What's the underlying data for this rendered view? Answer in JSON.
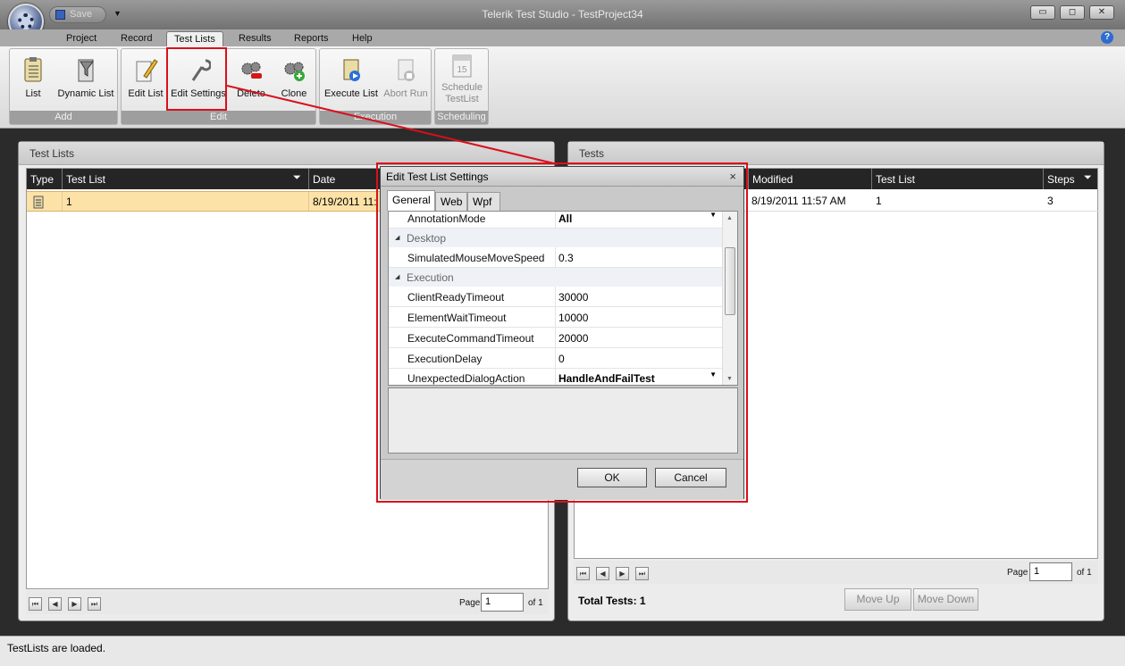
{
  "window": {
    "title": "Telerik Test Studio - TestProject34",
    "qat_save": "Save",
    "controls": [
      "▭",
      "◻",
      "✕"
    ]
  },
  "menu": {
    "tabs": [
      "Project",
      "Record",
      "Test Lists",
      "Results",
      "Reports",
      "Help"
    ],
    "active": "Test Lists",
    "help": "?"
  },
  "ribbon": {
    "groups": [
      {
        "label": "Add",
        "buttons": [
          "List",
          "Dynamic List"
        ]
      },
      {
        "label": "Edit",
        "buttons": [
          "Edit List",
          "Edit Settings",
          "Delete",
          "Clone"
        ]
      },
      {
        "label": "Execution",
        "buttons": [
          "Execute List",
          "Abort Run"
        ]
      },
      {
        "label": "Scheduling",
        "buttons": [
          "Schedule TestList"
        ]
      }
    ],
    "calendar_day": "15"
  },
  "left_panel": {
    "title": "Test Lists",
    "columns": [
      "Type",
      "Test List",
      "Date"
    ],
    "row": {
      "name": "1",
      "date": "8/19/2011 11:"
    },
    "pager": {
      "page_label": "Page",
      "page_value": "1",
      "of_label": "of 1"
    }
  },
  "right_panel": {
    "title": "Tests",
    "columns": [
      "Modified",
      "Test List",
      "Steps"
    ],
    "row": {
      "modified": "8/19/2011 11:57 AM",
      "list": "1",
      "steps": "3"
    },
    "pager": {
      "page_label": "Page",
      "page_value": "1",
      "of_label": "of 1"
    },
    "total": "Total Tests: 1",
    "move_up": "Move Up",
    "move_down": "Move Down"
  },
  "dialog": {
    "title": "Edit Test List Settings",
    "close": "×",
    "tabs": [
      "General",
      "Web",
      "Wpf"
    ],
    "rows": [
      {
        "type": "prop",
        "name": "AnnotationMode",
        "value": "All",
        "bold": true,
        "dropdown": true
      },
      {
        "type": "cat",
        "name": "Desktop"
      },
      {
        "type": "prop",
        "name": "SimulatedMouseMoveSpeed",
        "value": "0.3"
      },
      {
        "type": "cat",
        "name": "Execution"
      },
      {
        "type": "prop",
        "name": "ClientReadyTimeout",
        "value": "30000"
      },
      {
        "type": "prop",
        "name": "ElementWaitTimeout",
        "value": "10000"
      },
      {
        "type": "prop",
        "name": "ExecuteCommandTimeout",
        "value": "20000"
      },
      {
        "type": "prop",
        "name": "ExecutionDelay",
        "value": "0"
      },
      {
        "type": "prop",
        "name": "UnexpectedDialogAction",
        "value": "HandleAndFailTest",
        "bold": true,
        "dropdown": true
      }
    ],
    "ok": "OK",
    "cancel": "Cancel"
  },
  "status": "TestLists are loaded.",
  "colors": {
    "highlight": "#d9101c",
    "selected_row": "#fde2a8",
    "grid_header": "#252525"
  }
}
